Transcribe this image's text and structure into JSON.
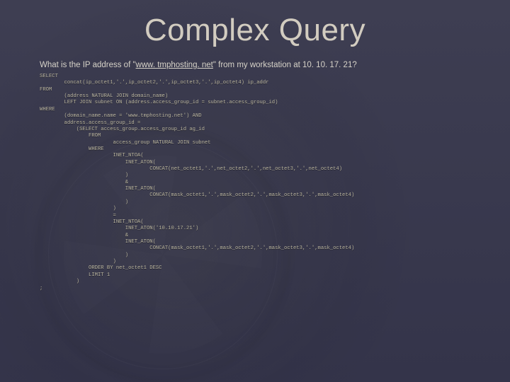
{
  "title": "Complex Query",
  "subtitle_prefix": "What is the IP address of \"",
  "subtitle_link": "www. tmphosting. net",
  "subtitle_suffix": "\" from my workstation at 10. 10. 17. 21?",
  "sql_lines": [
    "SELECT",
    "        concat(ip_octet1,'.',ip_octet2,'.',ip_octet3,'.',ip_octet4) ip_addr",
    "FROM",
    "        (address NATURAL JOIN domain_name)",
    "        LEFT JOIN subnet ON (address.access_group_id = subnet.access_group_id)",
    "WHERE",
    "        (domain_name.name = 'www.tmphosting.net') AND",
    "        address.access_group_id =",
    "            (SELECT access_group.access_group_id ag_id",
    "                FROM",
    "                        access_group NATURAL JOIN subnet",
    "                WHERE",
    "                        INET_NTOA(",
    "                            INET_ATON(",
    "                                    CONCAT(net_octet1,'.',net_octet2,'.',net_octet3,'.',net_octet4)",
    "                            )",
    "                            &",
    "                            INET_ATON(",
    "                                    CONCAT(mask_octet1,'.',mask_octet2,'.',mask_octet3,'.',mask_octet4)",
    "                            )",
    "                        )",
    "                        =",
    "                        INET_NTOA(",
    "                            INET_ATON('10.10.17.21')",
    "                            &",
    "                            INET_ATON(",
    "                                    CONCAT(mask_octet1,'.',mask_octet2,'.',mask_octet3,'.',mask_octet4)",
    "                            )",
    "                        )",
    "                ORDER BY net_octet1 DESC",
    "                LIMIT 1",
    "            )",
    ";"
  ]
}
